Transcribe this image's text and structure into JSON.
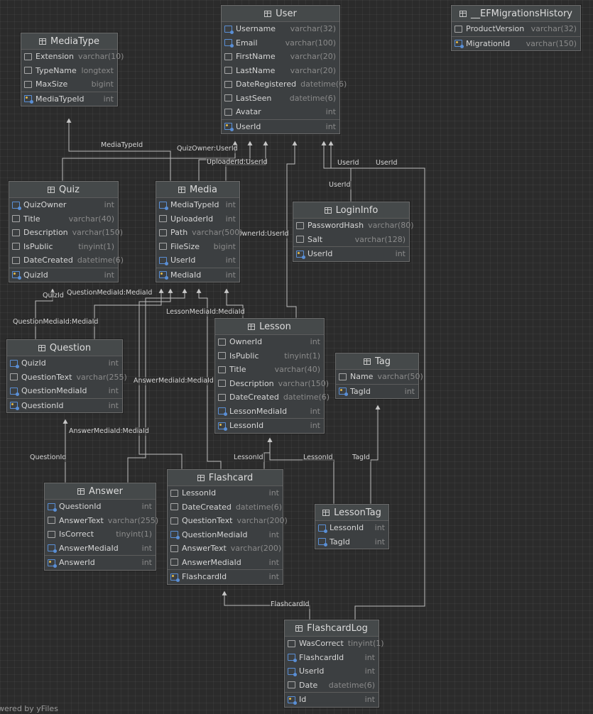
{
  "tables": [
    {
      "id": "user",
      "name": "User",
      "columns": [
        {
          "name": "Username",
          "type": "varchar(32)",
          "kind": "fk"
        },
        {
          "name": "Email",
          "type": "varchar(100)",
          "kind": "fk"
        },
        {
          "name": "FirstName",
          "type": "varchar(20)",
          "kind": "col"
        },
        {
          "name": "LastName",
          "type": "varchar(20)",
          "kind": "col"
        },
        {
          "name": "DateRegistered",
          "type": "datetime(6)",
          "kind": "col"
        },
        {
          "name": "LastSeen",
          "type": "datetime(6)",
          "kind": "col"
        },
        {
          "name": "Avatar",
          "type": "int",
          "kind": "col"
        },
        {
          "name": "UserId",
          "type": "int",
          "kind": "pk"
        }
      ]
    },
    {
      "id": "efmig",
      "name": "__EFMigrationsHistory",
      "columns": [
        {
          "name": "ProductVersion",
          "type": "varchar(32)",
          "kind": "col"
        },
        {
          "name": "MigrationId",
          "type": "varchar(150)",
          "kind": "pk"
        }
      ]
    },
    {
      "id": "mediatype",
      "name": "MediaType",
      "columns": [
        {
          "name": "Extension",
          "type": "varchar(10)",
          "kind": "col"
        },
        {
          "name": "TypeName",
          "type": "longtext",
          "kind": "col"
        },
        {
          "name": "MaxSize",
          "type": "bigint",
          "kind": "col"
        },
        {
          "name": "MediaTypeId",
          "type": "int",
          "kind": "pk"
        }
      ]
    },
    {
      "id": "quiz",
      "name": "Quiz",
      "columns": [
        {
          "name": "QuizOwner",
          "type": "int",
          "kind": "fk"
        },
        {
          "name": "Title",
          "type": "varchar(40)",
          "kind": "col"
        },
        {
          "name": "Description",
          "type": "varchar(150)",
          "kind": "col"
        },
        {
          "name": "IsPublic",
          "type": "tinyint(1)",
          "kind": "col"
        },
        {
          "name": "DateCreated",
          "type": "datetime(6)",
          "kind": "col"
        },
        {
          "name": "QuizId",
          "type": "int",
          "kind": "pk"
        }
      ]
    },
    {
      "id": "media",
      "name": "Media",
      "columns": [
        {
          "name": "MediaTypeId",
          "type": "int",
          "kind": "fk"
        },
        {
          "name": "UploaderId",
          "type": "int",
          "kind": "col"
        },
        {
          "name": "Path",
          "type": "varchar(500)",
          "kind": "col"
        },
        {
          "name": "FileSize",
          "type": "bigint",
          "kind": "col"
        },
        {
          "name": "UserId",
          "type": "int",
          "kind": "fk"
        },
        {
          "name": "MediaId",
          "type": "int",
          "kind": "pk"
        }
      ]
    },
    {
      "id": "logininfo",
      "name": "LoginInfo",
      "columns": [
        {
          "name": "PasswordHash",
          "type": "varchar(80)",
          "kind": "col"
        },
        {
          "name": "Salt",
          "type": "varchar(128)",
          "kind": "col"
        },
        {
          "name": "UserId",
          "type": "int",
          "kind": "pk"
        }
      ]
    },
    {
      "id": "lesson",
      "name": "Lesson",
      "columns": [
        {
          "name": "OwnerId",
          "type": "int",
          "kind": "col"
        },
        {
          "name": "IsPublic",
          "type": "tinyint(1)",
          "kind": "col"
        },
        {
          "name": "Title",
          "type": "varchar(40)",
          "kind": "col"
        },
        {
          "name": "Description",
          "type": "varchar(150)",
          "kind": "col"
        },
        {
          "name": "DateCreated",
          "type": "datetime(6)",
          "kind": "col"
        },
        {
          "name": "LessonMediaId",
          "type": "int",
          "kind": "fk"
        },
        {
          "name": "LessonId",
          "type": "int",
          "kind": "pk"
        }
      ]
    },
    {
      "id": "tag",
      "name": "Tag",
      "columns": [
        {
          "name": "Name",
          "type": "varchar(50)",
          "kind": "col"
        },
        {
          "name": "TagId",
          "type": "int",
          "kind": "pk"
        }
      ]
    },
    {
      "id": "question",
      "name": "Question",
      "columns": [
        {
          "name": "QuizId",
          "type": "int",
          "kind": "fk"
        },
        {
          "name": "QuestionText",
          "type": "varchar(255)",
          "kind": "col"
        },
        {
          "name": "QuestionMediaId",
          "type": "int",
          "kind": "fk"
        },
        {
          "name": "QuestionId",
          "type": "int",
          "kind": "pk"
        }
      ]
    },
    {
      "id": "answer",
      "name": "Answer",
      "columns": [
        {
          "name": "QuestionId",
          "type": "int",
          "kind": "fk"
        },
        {
          "name": "AnswerText",
          "type": "varchar(255)",
          "kind": "col"
        },
        {
          "name": "IsCorrect",
          "type": "tinyint(1)",
          "kind": "col"
        },
        {
          "name": "AnswerMediaId",
          "type": "int",
          "kind": "fk"
        },
        {
          "name": "AnswerId",
          "type": "int",
          "kind": "pk"
        }
      ]
    },
    {
      "id": "flashcard",
      "name": "Flashcard",
      "columns": [
        {
          "name": "LessonId",
          "type": "int",
          "kind": "col"
        },
        {
          "name": "DateCreated",
          "type": "datetime(6)",
          "kind": "col"
        },
        {
          "name": "QuestionText",
          "type": "varchar(200)",
          "kind": "col"
        },
        {
          "name": "QuestionMediaId",
          "type": "int",
          "kind": "fk"
        },
        {
          "name": "AnswerText",
          "type": "varchar(200)",
          "kind": "col"
        },
        {
          "name": "AnswerMediaId",
          "type": "int",
          "kind": "col"
        },
        {
          "name": "FlashcardId",
          "type": "int",
          "kind": "pk"
        }
      ]
    },
    {
      "id": "lessontag",
      "name": "LessonTag",
      "columns": [
        {
          "name": "LessonId",
          "type": "int",
          "kind": "fk"
        },
        {
          "name": "TagId",
          "type": "int",
          "kind": "fk"
        }
      ]
    },
    {
      "id": "flashcardlog",
      "name": "FlashcardLog",
      "columns": [
        {
          "name": "WasCorrect",
          "type": "tinyint(1)",
          "kind": "col"
        },
        {
          "name": "FlashcardId",
          "type": "int",
          "kind": "fk"
        },
        {
          "name": "UserId",
          "type": "int",
          "kind": "fk"
        },
        {
          "name": "Date",
          "type": "datetime(6)",
          "kind": "col"
        },
        {
          "name": "Id",
          "type": "int",
          "kind": "pk"
        }
      ]
    }
  ],
  "edge_labels": [
    "MediaTypeId",
    "QuizOwner:UserId",
    "UploaderId:UserId",
    "UserId",
    "UserId",
    "UserId",
    "OwnerId:UserId",
    "QuizId",
    "QuestionMediaId:MediaId",
    "QuestionMediaId:MediaId",
    "LessonMediaId:MediaId",
    "AnswerMediaId:MediaId",
    "AnswerMediaId:MediaId",
    "QuestionId",
    "LessonId",
    "LessonId",
    "TagId",
    "FlashcardId"
  ],
  "footer": "wered by yFiles"
}
